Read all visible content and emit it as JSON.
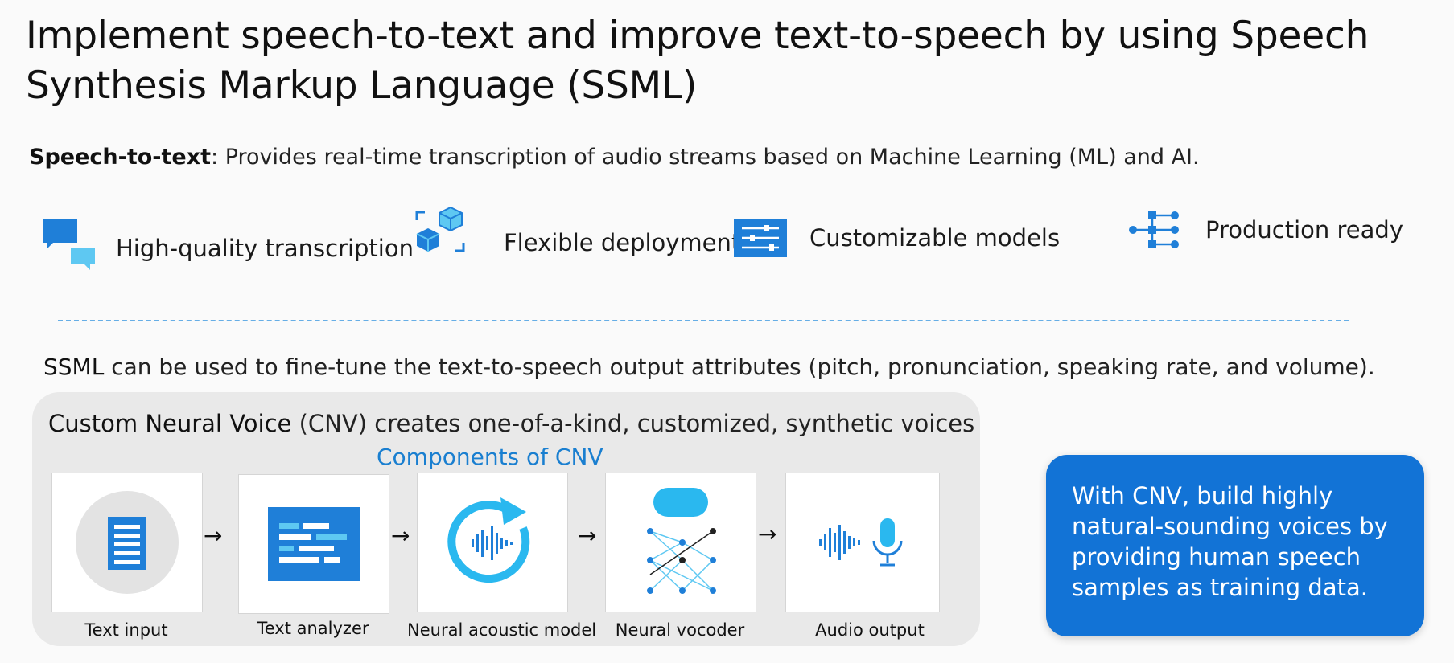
{
  "title": "Implement speech-to-text and improve text-to-speech by using Speech Synthesis Markup Language (SSML)",
  "speech_to_text": {
    "term": "Speech-to-text",
    "description": ": Provides real-time transcription of audio streams based on Machine Learning (ML) and AI."
  },
  "features": [
    {
      "label": "High-quality transcription",
      "icon": "chat-bubbles-icon"
    },
    {
      "label": "Flexible deployment",
      "icon": "deployment-cubes-icon"
    },
    {
      "label": "Customizable models",
      "icon": "sliders-icon"
    },
    {
      "label": "Production ready",
      "icon": "network-nodes-icon"
    }
  ],
  "ssml": {
    "term": "SSML",
    "description": " can be used to fine-tune the text-to-speech output attributes (pitch, pronunciation, speaking rate, and volume)."
  },
  "cnv": {
    "term": "Custom Neural Voice",
    "description": " (CNV) creates one-of-a-kind, customized, synthetic voices",
    "components_title": "Components of CNV",
    "components": [
      {
        "label": "Text input",
        "icon": "document-icon"
      },
      {
        "label": "Text analyzer",
        "icon": "text-analyzer-icon"
      },
      {
        "label": "Neural acoustic model",
        "icon": "acoustic-model-icon"
      },
      {
        "label": "Neural vocoder",
        "icon": "neural-network-icon"
      },
      {
        "label": "Audio output",
        "icon": "microphone-waveform-icon"
      }
    ],
    "arrow": "→"
  },
  "callout": {
    "text": "With CNV, build highly natural-sounding voices by providing human speech samples as training data."
  },
  "colors": {
    "accent": "#1273d6",
    "link_blue": "#1a7fd0",
    "icon_blue": "#1f7fd8",
    "icon_light": "#5ec8f2"
  }
}
